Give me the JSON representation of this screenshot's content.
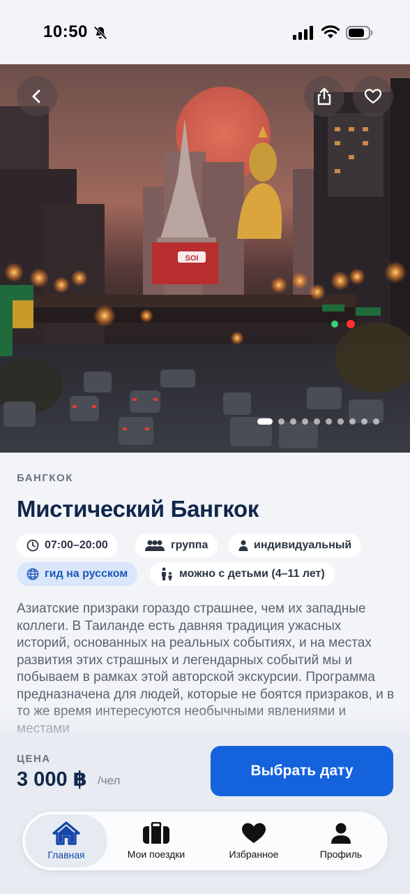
{
  "status_bar": {
    "time": "10:50",
    "icons": [
      "bell-slash-icon",
      "signal-icon",
      "wifi-icon",
      "battery-icon"
    ]
  },
  "hero": {
    "sign_text": "SOI",
    "carousel": {
      "total": 10,
      "active_index": 0
    },
    "buttons": [
      "back-icon",
      "share-icon",
      "heart-icon"
    ]
  },
  "tour": {
    "city": "БАНГКОК",
    "title": "Мистический Бангкок",
    "chips": {
      "time": "07:00–20:00",
      "group": "группа",
      "individual": "индивидуальный",
      "guide": "гид на русском",
      "kids": "можно с детьми (4–11 лет)"
    },
    "description": "Азиатские призраки гораздо страшнее, чем их западные коллеги. В Таиланде есть давняя традиция ужасных историй, основанных на реальных событиях, и на местах развития этих страшных и легендарных событий мы и побываем в рамках этой авторской экскурсии. Программа предназначена для людей, которые не боятся призраков, и в то же время интересуются необычными явлениями и местами"
  },
  "price": {
    "label": "ЦЕНА",
    "value": "3 000 ฿",
    "unit": "/чел"
  },
  "cta": {
    "label": "Выбрать дату"
  },
  "tabbar": {
    "items": [
      {
        "label": "Главная",
        "icon": "home-icon",
        "active": true
      },
      {
        "label": "Мои поездки",
        "icon": "suitcase-icon",
        "active": false
      },
      {
        "label": "Избранное",
        "icon": "heart-icon",
        "active": false
      },
      {
        "label": "Профиль",
        "icon": "person-icon",
        "active": false
      }
    ]
  },
  "colors": {
    "accent": "#1463dd",
    "title": "#10264a",
    "chip_blue_bg": "#d9e6fb",
    "active_tab": "#1546a8"
  }
}
